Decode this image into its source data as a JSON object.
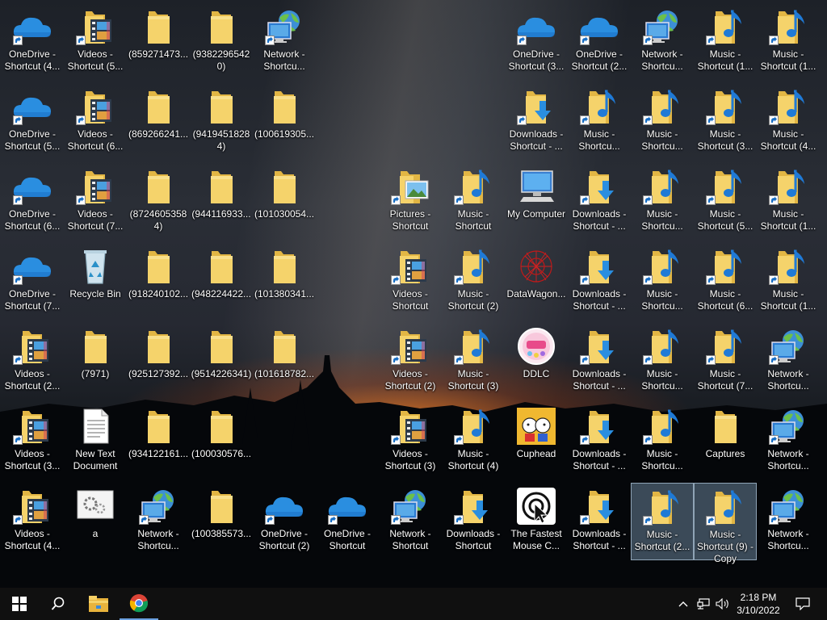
{
  "desktop": {
    "icons": [
      {
        "label": "OneDrive - Shortcut (4...",
        "icon": "onedrive-icon",
        "type": "cloud",
        "shortcut": true
      },
      {
        "label": "Videos - Shortcut (5...",
        "icon": "videos-folder-icon",
        "type": "videos",
        "shortcut": true
      },
      {
        "label": "(859271473...",
        "icon": "folder-icon",
        "type": "folder",
        "shortcut": false
      },
      {
        "label": "(93822965420)",
        "icon": "folder-icon",
        "type": "folder",
        "shortcut": false
      },
      {
        "label": "Network - Shortcu...",
        "icon": "network-icon",
        "type": "network",
        "shortcut": true
      },
      {
        "label": "OneDrive - Shortcut (3...",
        "icon": "onedrive-icon",
        "type": "cloud",
        "shortcut": true
      },
      {
        "label": "OneDrive - Shortcut (2...",
        "icon": "onedrive-icon",
        "type": "cloud",
        "shortcut": true
      },
      {
        "label": "Network - Shortcu...",
        "icon": "network-icon",
        "type": "network",
        "shortcut": true
      },
      {
        "label": "Music - Shortcut (1...",
        "icon": "music-folder-icon",
        "type": "music",
        "shortcut": true
      },
      {
        "label": "Music - Shortcut (1...",
        "icon": "music-folder-icon",
        "type": "music",
        "shortcut": true
      },
      {
        "label": "OneDrive - Shortcut (5...",
        "icon": "onedrive-icon",
        "type": "cloud",
        "shortcut": true
      },
      {
        "label": "Videos - Shortcut (6...",
        "icon": "videos-folder-icon",
        "type": "videos",
        "shortcut": true
      },
      {
        "label": "(869266241...",
        "icon": "folder-icon",
        "type": "folder",
        "shortcut": false
      },
      {
        "label": "(94194518284)",
        "icon": "folder-icon",
        "type": "folder",
        "shortcut": false
      },
      {
        "label": "(100619305...",
        "icon": "folder-icon",
        "type": "folder",
        "shortcut": false
      },
      {
        "label": "Downloads - Shortcut - ...",
        "icon": "downloads-folder-icon",
        "type": "downloads",
        "shortcut": true
      },
      {
        "label": "Music - Shortcu...",
        "icon": "music-folder-icon",
        "type": "music",
        "shortcut": true
      },
      {
        "label": "Music - Shortcu...",
        "icon": "music-folder-icon",
        "type": "music",
        "shortcut": true
      },
      {
        "label": "Music - Shortcut (3...",
        "icon": "music-folder-icon",
        "type": "music",
        "shortcut": true
      },
      {
        "label": "Music - Shortcut (4...",
        "icon": "music-folder-icon",
        "type": "music",
        "shortcut": true
      },
      {
        "label": "OneDrive - Shortcut (6...",
        "icon": "onedrive-icon",
        "type": "cloud",
        "shortcut": true
      },
      {
        "label": "Videos - Shortcut (7...",
        "icon": "videos-folder-icon",
        "type": "videos",
        "shortcut": true
      },
      {
        "label": "(87246053584)",
        "icon": "folder-icon",
        "type": "folder",
        "shortcut": false
      },
      {
        "label": "(944116933...",
        "icon": "folder-icon",
        "type": "folder",
        "shortcut": false
      },
      {
        "label": "(101030054...",
        "icon": "folder-icon",
        "type": "folder",
        "shortcut": false
      },
      {
        "label": "Pictures - Shortcut",
        "icon": "pictures-folder-icon",
        "type": "pictures",
        "shortcut": true
      },
      {
        "label": "Music - Shortcut",
        "icon": "music-folder-icon",
        "type": "music",
        "shortcut": true
      },
      {
        "label": "My Computer",
        "icon": "computer-icon",
        "type": "computer",
        "shortcut": false
      },
      {
        "label": "Downloads - Shortcut - ...",
        "icon": "downloads-folder-icon",
        "type": "downloads",
        "shortcut": true
      },
      {
        "label": "Music - Shortcu...",
        "icon": "music-folder-icon",
        "type": "music",
        "shortcut": true
      },
      {
        "label": "Music - Shortcut (5...",
        "icon": "music-folder-icon",
        "type": "music",
        "shortcut": true
      },
      {
        "label": "Music - Shortcut (1...",
        "icon": "music-folder-icon",
        "type": "music",
        "shortcut": true
      },
      {
        "label": "OneDrive - Shortcut (7...",
        "icon": "onedrive-icon",
        "type": "cloud",
        "shortcut": true
      },
      {
        "label": "Recycle Bin",
        "icon": "recycle-bin-icon",
        "type": "recycle",
        "shortcut": false
      },
      {
        "label": "(918240102...",
        "icon": "folder-icon",
        "type": "folder",
        "shortcut": false
      },
      {
        "label": "(948224422...",
        "icon": "folder-icon",
        "type": "folder",
        "shortcut": false
      },
      {
        "label": "(101380341...",
        "icon": "folder-icon",
        "type": "folder",
        "shortcut": false
      },
      {
        "label": "Videos - Shortcut",
        "icon": "videos-folder-icon",
        "type": "videos",
        "shortcut": true
      },
      {
        "label": "Music - Shortcut (2)",
        "icon": "music-folder-icon",
        "type": "music",
        "shortcut": true
      },
      {
        "label": "DataWagon...",
        "icon": "datawagon-icon",
        "type": "datawagon",
        "shortcut": false
      },
      {
        "label": "Downloads - Shortcut - ...",
        "icon": "downloads-folder-icon",
        "type": "downloads",
        "shortcut": true
      },
      {
        "label": "Music - Shortcu...",
        "icon": "music-folder-icon",
        "type": "music",
        "shortcut": true
      },
      {
        "label": "Music - Shortcut (6...",
        "icon": "music-folder-icon",
        "type": "music",
        "shortcut": true
      },
      {
        "label": "Music - Shortcut (1...",
        "icon": "music-folder-icon",
        "type": "music",
        "shortcut": true
      },
      {
        "label": "Videos - Shortcut (2...",
        "icon": "videos-folder-icon",
        "type": "videos",
        "shortcut": true
      },
      {
        "label": "(7971)",
        "icon": "folder-icon",
        "type": "folder",
        "shortcut": false
      },
      {
        "label": "(925127392...",
        "icon": "folder-icon",
        "type": "folder",
        "shortcut": false
      },
      {
        "label": "(9514226341)",
        "icon": "folder-icon",
        "type": "folder",
        "shortcut": false
      },
      {
        "label": "(101618782...",
        "icon": "folder-icon",
        "type": "folder",
        "shortcut": false
      },
      {
        "label": "Videos - Shortcut (2)",
        "icon": "videos-folder-icon",
        "type": "videos",
        "shortcut": true
      },
      {
        "label": "Music - Shortcut (3)",
        "icon": "music-folder-icon",
        "type": "music",
        "shortcut": true
      },
      {
        "label": "DDLC",
        "icon": "ddlc-icon",
        "type": "ddlc",
        "shortcut": false
      },
      {
        "label": "Downloads - Shortcut - ...",
        "icon": "downloads-folder-icon",
        "type": "downloads",
        "shortcut": true
      },
      {
        "label": "Music - Shortcu...",
        "icon": "music-folder-icon",
        "type": "music",
        "shortcut": true
      },
      {
        "label": "Music - Shortcut (7...",
        "icon": "music-folder-icon",
        "type": "music",
        "shortcut": true
      },
      {
        "label": "Network - Shortcu...",
        "icon": "network-icon",
        "type": "network",
        "shortcut": true
      },
      {
        "label": "Videos - Shortcut (3...",
        "icon": "videos-folder-icon",
        "type": "videos",
        "shortcut": true
      },
      {
        "label": "New Text Document",
        "icon": "text-document-icon",
        "type": "textdoc",
        "shortcut": false
      },
      {
        "label": "(934122161...",
        "icon": "folder-icon",
        "type": "folder",
        "shortcut": false
      },
      {
        "label": "(100030576...",
        "icon": "folder-icon",
        "type": "folder",
        "shortcut": false
      },
      {
        "label": "Videos - Shortcut (3)",
        "icon": "videos-folder-icon",
        "type": "videos",
        "shortcut": true
      },
      {
        "label": "Music - Shortcut (4)",
        "icon": "music-folder-icon",
        "type": "music",
        "shortcut": true
      },
      {
        "label": "Cuphead",
        "icon": "cuphead-icon",
        "type": "cuphead",
        "shortcut": false
      },
      {
        "label": "Downloads - Shortcut - ...",
        "icon": "downloads-folder-icon",
        "type": "downloads",
        "shortcut": true
      },
      {
        "label": "Music - Shortcu...",
        "icon": "music-folder-icon",
        "type": "music",
        "shortcut": true
      },
      {
        "label": "Captures",
        "icon": "folder-icon",
        "type": "folder",
        "shortcut": false
      },
      {
        "label": "Network - Shortcu...",
        "icon": "network-icon",
        "type": "network",
        "shortcut": true
      },
      {
        "label": "Videos - Shortcut (4...",
        "icon": "videos-folder-icon",
        "type": "videos",
        "shortcut": true
      },
      {
        "label": "a",
        "icon": "settings-file-icon",
        "type": "config",
        "shortcut": false
      },
      {
        "label": "Network - Shortcu...",
        "icon": "network-icon",
        "type": "network",
        "shortcut": true
      },
      {
        "label": "(100385573...",
        "icon": "folder-icon",
        "type": "folder",
        "shortcut": false
      },
      {
        "label": "OneDrive - Shortcut (2)",
        "icon": "onedrive-icon",
        "type": "cloud",
        "shortcut": true
      },
      {
        "label": "OneDrive - Shortcut",
        "icon": "onedrive-icon",
        "type": "cloud",
        "shortcut": true
      },
      {
        "label": "Network - Shortcut",
        "icon": "network-icon",
        "type": "network",
        "shortcut": true
      },
      {
        "label": "Downloads - Shortcut",
        "icon": "downloads-folder-icon",
        "type": "downloads",
        "shortcut": true
      },
      {
        "label": "The Fastest Mouse C...",
        "icon": "fastest-mouse-icon",
        "type": "mouse",
        "shortcut": false
      },
      {
        "label": "Downloads - Shortcut - ...",
        "icon": "downloads-folder-icon",
        "type": "downloads",
        "shortcut": true
      },
      {
        "label": "Music - Shortcut (2...",
        "icon": "music-folder-icon",
        "type": "music",
        "shortcut": true,
        "selected": true
      },
      {
        "label": "Music - Shortcut (9) - Copy",
        "icon": "music-folder-icon",
        "type": "music",
        "shortcut": true,
        "selected": true
      },
      {
        "label": "Network - Shortcu...",
        "icon": "network-icon",
        "type": "network",
        "shortcut": true
      }
    ]
  },
  "taskbar": {
    "start_icon": "windows-start-icon",
    "search_icon": "search-icon",
    "pinned": [
      {
        "name": "file-explorer",
        "icon": "file-explorer-icon"
      },
      {
        "name": "chrome",
        "icon": "chrome-icon",
        "active": true
      }
    ],
    "tray": {
      "chevron_icon": "chevron-up-icon",
      "network_icon": "network-tray-icon",
      "volume_icon": "volume-icon"
    },
    "clock": {
      "time": "2:18 PM",
      "date": "3/10/2022"
    },
    "notification_icon": "notification-icon"
  },
  "colors": {
    "folder": "#f5d36b",
    "folder_dark": "#e2b644",
    "onedrive": "#2a8ee0",
    "taskbar": "#101010",
    "accent": "#6aa0e0",
    "grass": "#8ed43a"
  }
}
